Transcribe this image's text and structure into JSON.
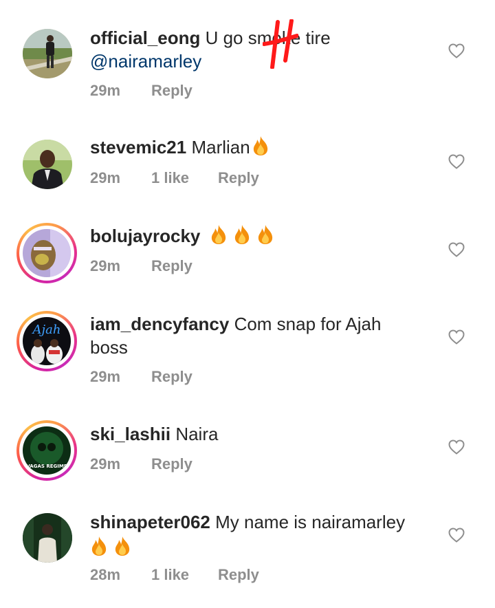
{
  "comments": [
    {
      "username": "official_eong",
      "text": "U go smoke tire",
      "mention": "@nairamarley",
      "time": "29m",
      "likes": "",
      "reply": "Reply"
    },
    {
      "username": "stevemic21",
      "text": "Marlian",
      "time": "29m",
      "likes": "1 like",
      "reply": "Reply"
    },
    {
      "username": "bolujayrocky",
      "text": "",
      "time": "29m",
      "likes": "",
      "reply": "Reply"
    },
    {
      "username": "iam_dencyfancy",
      "text": "Com snap for Ajah",
      "text2": "boss",
      "time": "29m",
      "likes": "",
      "reply": "Reply"
    },
    {
      "username": "ski_lashii",
      "text": "Naira",
      "time": "29m",
      "likes": "",
      "reply": "Reply"
    },
    {
      "username": "shinapeter062",
      "text": "My name is nairamarley",
      "time": "28m",
      "likes": "1 like",
      "reply": "Reply"
    }
  ],
  "avatar_texts": {
    "dency": "Ajah",
    "ski": "VAGAS REGIME"
  },
  "icons": {
    "like": "heart-outline-icon",
    "emoji": "fire-emoji-icon"
  },
  "colors": {
    "username": "#262626",
    "mention": "#00376b",
    "meta": "#8e8e8e",
    "ring_start": "#d6249f",
    "ring_end": "#fdbc49",
    "scribble": "#ff1a1a"
  }
}
